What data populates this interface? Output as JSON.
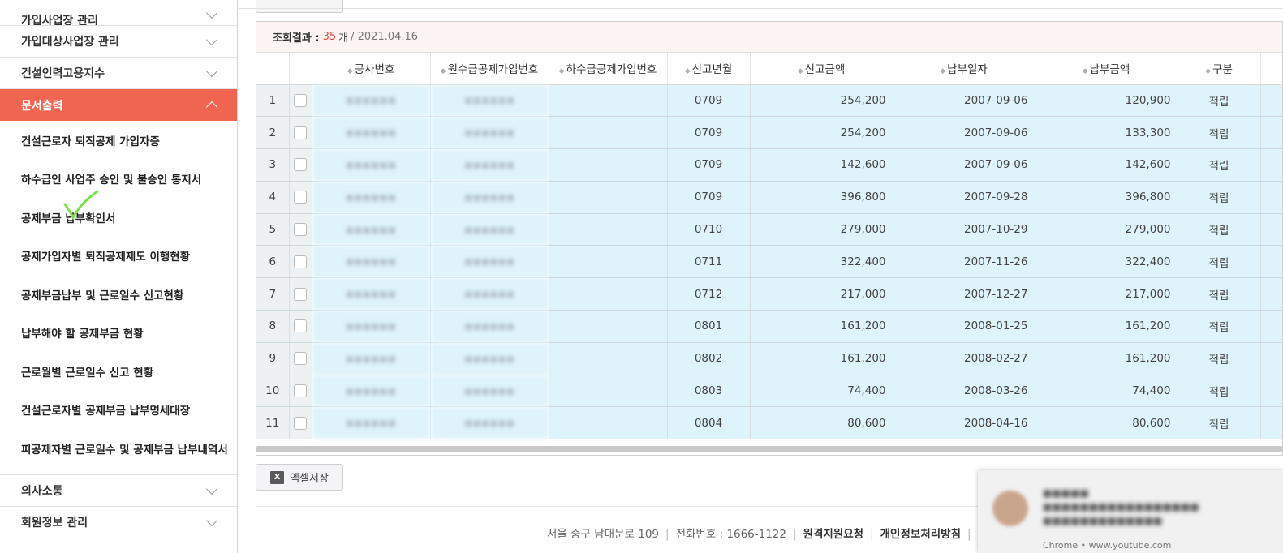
{
  "sidebar": {
    "categories_top": [
      {
        "label": "가입사업장 관리"
      },
      {
        "label": "가입대상사업장 관리"
      },
      {
        "label": "건설인력고용지수"
      }
    ],
    "active_category": {
      "label": "문서출력"
    },
    "sub_items": [
      {
        "label": "건설근로자 퇴직공제 가입자증"
      },
      {
        "label": "하수급인 사업주 승인 및 불승인 통지서"
      },
      {
        "label": "공제부금 납부확인서"
      },
      {
        "label": "공제가입자별 퇴직공제제도 이행현황"
      },
      {
        "label": "공제부금납부 및 근로일수 신고현황"
      },
      {
        "label": "납부해야 할 공제부금 현황"
      },
      {
        "label": "근로월별 근로일수 신고 현황"
      },
      {
        "label": "건설근로자별 공제부금 납부명세대장"
      },
      {
        "label": "피공제자별 근로일수 및 공제부금 납부내역서"
      }
    ],
    "categories_bottom": [
      {
        "label": "의사소통"
      },
      {
        "label": "회원정보 관리"
      }
    ]
  },
  "result": {
    "label": "조회결과 :",
    "count": "35",
    "unit": "개",
    "date": "/ 2021.04.16"
  },
  "table": {
    "headers": [
      "공사번호",
      "원수급공제가입번호",
      "하수급공제가입번호",
      "신고년월",
      "신고금액",
      "납부일자",
      "납부금액",
      "구분"
    ],
    "rows": [
      {
        "no": "1",
        "ym": "0709",
        "report": "254,200",
        "paydate": "2007-09-06",
        "payamt": "120,900",
        "type": "적립"
      },
      {
        "no": "2",
        "ym": "0709",
        "report": "254,200",
        "paydate": "2007-09-06",
        "payamt": "133,300",
        "type": "적립"
      },
      {
        "no": "3",
        "ym": "0709",
        "report": "142,600",
        "paydate": "2007-09-06",
        "payamt": "142,600",
        "type": "적립"
      },
      {
        "no": "4",
        "ym": "0709",
        "report": "396,800",
        "paydate": "2007-09-28",
        "payamt": "396,800",
        "type": "적립"
      },
      {
        "no": "5",
        "ym": "0710",
        "report": "279,000",
        "paydate": "2007-10-29",
        "payamt": "279,000",
        "type": "적립"
      },
      {
        "no": "6",
        "ym": "0711",
        "report": "322,400",
        "paydate": "2007-11-26",
        "payamt": "322,400",
        "type": "적립"
      },
      {
        "no": "7",
        "ym": "0712",
        "report": "217,000",
        "paydate": "2007-12-27",
        "payamt": "217,000",
        "type": "적립"
      },
      {
        "no": "8",
        "ym": "0801",
        "report": "161,200",
        "paydate": "2008-01-25",
        "payamt": "161,200",
        "type": "적립"
      },
      {
        "no": "9",
        "ym": "0802",
        "report": "161,200",
        "paydate": "2008-02-27",
        "payamt": "161,200",
        "type": "적립"
      },
      {
        "no": "10",
        "ym": "0803",
        "report": "74,400",
        "paydate": "2008-03-26",
        "payamt": "74,400",
        "type": "적립"
      },
      {
        "no": "11",
        "ym": "0804",
        "report": "80,600",
        "paydate": "2008-04-16",
        "payamt": "80,600",
        "type": "적립"
      }
    ]
  },
  "excel_button": {
    "label": "엑셀저장",
    "icon": "excel-icon"
  },
  "footer": {
    "address": "서울 중구 남대문로 109",
    "phone": "전화번호 : 1666-1122",
    "link_remote": "원격지원요청",
    "link_privacy": "개인정보처리방침"
  },
  "toast": {
    "source": "Chrome • www.youtube.com"
  },
  "colors": {
    "accent": "#f06452",
    "row_bg": "#def3fa",
    "count_red": "#e2473b"
  }
}
